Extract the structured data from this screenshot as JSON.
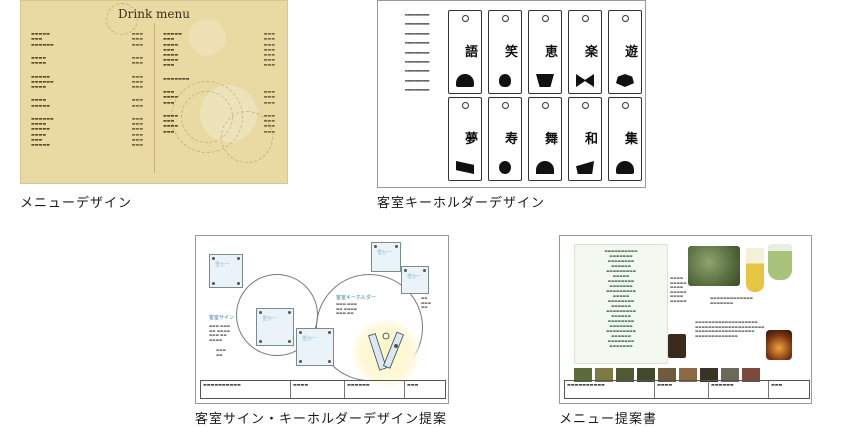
{
  "captions": {
    "menu": "メニューデザイン",
    "keyholder": "客室キーホルダーデザイン",
    "sign_proposal": "客室サイン・キーホルダーデザイン提案",
    "menu_proposal": "メニュー提案書"
  },
  "menu_card": {
    "title": "Drink menu"
  },
  "sign_card": {
    "square_label": "雪かー",
    "label_sign": "客室サイン",
    "label_keyholder": "客室キーホルダー"
  },
  "colors": {
    "menu_bg": "#e9d9a3",
    "sign_blue": "#3e7fa8",
    "proposal_green": "#2f5f3f"
  }
}
